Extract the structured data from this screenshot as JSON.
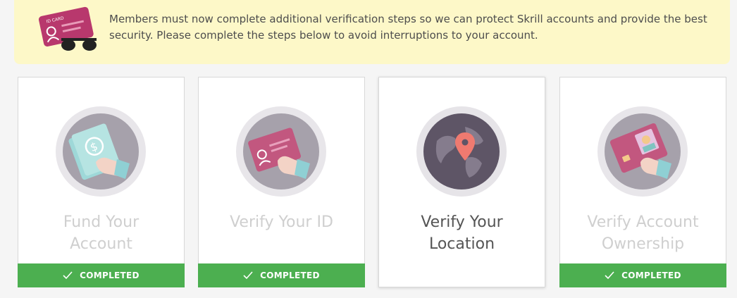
{
  "banner": {
    "message": "Members must now complete additional verification steps so we can protect Skrill accounts and provide the best security. Please complete the steps below to avoid interruptions to your account.",
    "illustration_icon": "id-card-sunglasses-icon",
    "card_label": "ID CARD"
  },
  "steps": [
    {
      "title": "Fund Your Account",
      "status": "COMPLETED",
      "icon": "money-hand-icon",
      "completed": true
    },
    {
      "title": "Verify Your ID",
      "status": "COMPLETED",
      "icon": "id-card-hand-icon",
      "completed": true
    },
    {
      "title": "Verify Your Location",
      "status": "",
      "icon": "globe-location-pin-icon",
      "completed": false
    },
    {
      "title": "Verify Account Ownership",
      "status": "COMPLETED",
      "icon": "card-photo-hand-icon",
      "completed": true
    }
  ],
  "colors": {
    "banner_bg": "#fdf8c8",
    "completed_green": "#4caf50",
    "card_pink": "#c2577f",
    "cuff_teal": "#8fd0d4",
    "pin_red": "#ef7a70"
  }
}
